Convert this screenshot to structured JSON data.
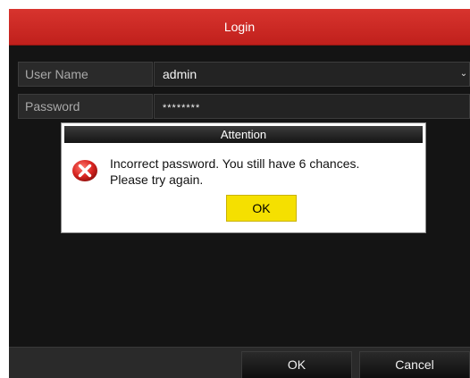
{
  "window": {
    "title": "Login"
  },
  "form": {
    "username_label": "User Name",
    "username_value": "admin",
    "password_label": "Password",
    "password_value": "********"
  },
  "dialog": {
    "title": "Attention",
    "message_line1": "Incorrect password. You still have 6 chances.",
    "message_line2": "Please try again.",
    "ok_label": "OK"
  },
  "footer": {
    "ok_label": "OK",
    "cancel_label": "Cancel"
  },
  "icons": {
    "error": "error-x-icon",
    "dropdown": "chevron-down-icon"
  },
  "colors": {
    "title_bar": "#d02a25",
    "dialog_ok_button": "#f5e000",
    "error_icon": "#d82420"
  }
}
